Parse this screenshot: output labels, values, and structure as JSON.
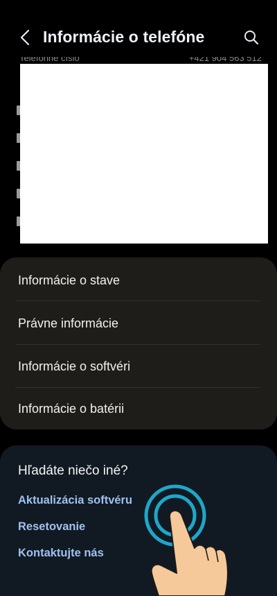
{
  "header": {
    "title": "Informácie o telefóne",
    "back_icon": "chevron-left-icon",
    "search_icon": "search-icon"
  },
  "partial_row": {
    "label": "Telefónne číslo",
    "value": "+421 904 563 512"
  },
  "menu": {
    "items": [
      {
        "label": "Informácie o stave"
      },
      {
        "label": "Právne informácie"
      },
      {
        "label": "Informácie o softvéri"
      },
      {
        "label": "Informácie o batérii"
      }
    ]
  },
  "suggestions": {
    "heading": "Hľadáte niečo iné?",
    "links": [
      {
        "label": "Aktualizácia softvéru"
      },
      {
        "label": "Resetovanie"
      },
      {
        "label": "Kontaktujte nás"
      }
    ]
  },
  "colors": {
    "background": "#000000",
    "card": "#1f1d1a",
    "suggestion_card": "#111a22",
    "link": "#9fc1f1",
    "tap_ring": "#1ea7c8",
    "hand_skin": "#f6c99b"
  }
}
